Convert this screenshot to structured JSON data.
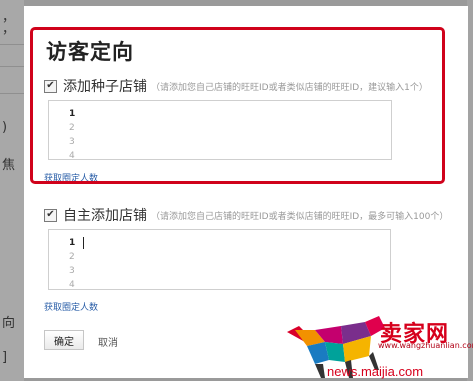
{
  "modal": {
    "title": "访客定向",
    "section1": {
      "label": "添加种子店铺",
      "hint": "（请添加您自己店铺的旺旺ID或者类似店铺的旺旺ID，建议输入1个）",
      "checked": true,
      "line_numbers": [
        "1",
        "2",
        "3",
        "4"
      ],
      "link": "获取圈定人数"
    },
    "section2": {
      "label": "自主添加店铺",
      "hint": "（请添加您自己店铺的旺旺ID或者类似店铺的旺旺ID，最多可输入100个）",
      "checked": true,
      "line_numbers": [
        "1",
        "2",
        "3",
        "4"
      ],
      "link": "获取圈定人数"
    },
    "confirm_label": "确定",
    "cancel_label": "取消",
    "check_glyph": "✔"
  },
  "background": {
    "fragments": [
      "，",
      "，",
      ")",
      "焦",
      "向",
      "]"
    ]
  },
  "watermark": {
    "brand": "卖家网",
    "url": "www.wangzhuanlian.com",
    "domain": "news.maijia.com"
  },
  "colors": {
    "highlight": "#d0021b",
    "link": "#2b5fa8",
    "watermark": "#d6001c"
  }
}
